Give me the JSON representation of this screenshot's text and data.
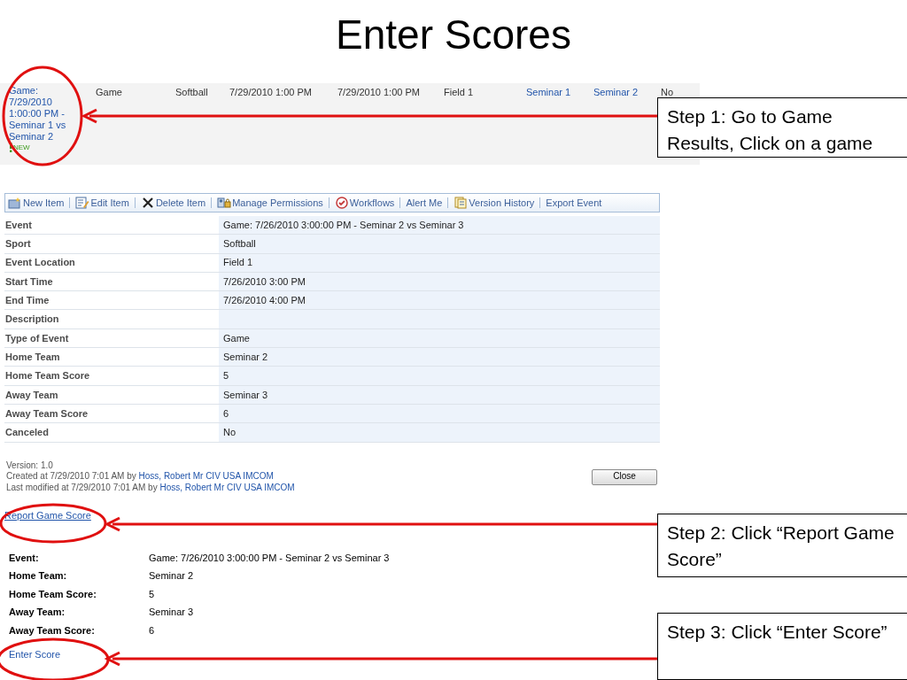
{
  "title": "Enter Scores",
  "results_row": {
    "event_link": "Game: 7/29/2010 1:00:00 PM - Seminar 1 vs Seminar 2",
    "new_badge": "NEW",
    "cells": [
      {
        "text": "Game",
        "link": false
      },
      {
        "text": "Softball",
        "link": false
      },
      {
        "text": "7/29/2010 1:00 PM",
        "link": false
      },
      {
        "text": "7/29/2010 1:00 PM",
        "link": false
      },
      {
        "text": "Field 1",
        "link": false
      },
      {
        "text": "Seminar 1",
        "link": true
      },
      {
        "text": "Seminar 2",
        "link": true
      },
      {
        "text": "No",
        "link": false
      }
    ]
  },
  "toolbar": [
    "New Item",
    "Edit Item",
    "Delete Item",
    "Manage Permissions",
    "Workflows",
    "Alert Me",
    "Version History",
    "Export Event"
  ],
  "details": [
    {
      "label": "Event",
      "value": "Game: 7/26/2010 3:00:00 PM - Seminar 2 vs Seminar 3"
    },
    {
      "label": "Sport",
      "value": "Softball"
    },
    {
      "label": "Event Location",
      "value": "Field 1"
    },
    {
      "label": "Start Time",
      "value": "7/26/2010 3:00 PM"
    },
    {
      "label": "End Time",
      "value": "7/26/2010 4:00 PM"
    },
    {
      "label": "Description"
    },
    {
      "label": "Type of Event",
      "value": "Game"
    },
    {
      "label": "Home Team",
      "value": "Seminar 2"
    },
    {
      "label": "Home Team Score",
      "value": "5"
    },
    {
      "label": "Away Team",
      "value": "Seminar 3"
    },
    {
      "label": "Away Team Score",
      "value": "6"
    },
    {
      "label": "Canceled",
      "value": "No"
    }
  ],
  "version": "Version: 1.0",
  "created": {
    "prefix": "Created at 7/29/2010 7:01 AM  by",
    "user": "Hoss, Robert Mr CIV USA IMCOM"
  },
  "modified": {
    "prefix": "Last modified at 7/29/2010 7:01 AM  by",
    "user": "Hoss, Robert Mr CIV USA IMCOM"
  },
  "close_button": "Close",
  "report_link": "Report Game Score",
  "score_form": [
    {
      "label": "Event:",
      "value": "Game: 7/26/2010 3:00:00 PM - Seminar 2 vs Seminar 3"
    },
    {
      "label": "Home Team:",
      "value": "Seminar 2"
    },
    {
      "label": "Home Team Score:",
      "value": "5"
    },
    {
      "label": "Away Team:",
      "value": "Seminar 3"
    },
    {
      "label": "Away Team Score:",
      "value": "6"
    }
  ],
  "enter_link": "Enter Score",
  "callouts": [
    "Step 1: Go to Game Results, Click on a game",
    "Step 2: Click  “Report Game Score”",
    "Step 3: Click  “Enter Score”"
  ]
}
